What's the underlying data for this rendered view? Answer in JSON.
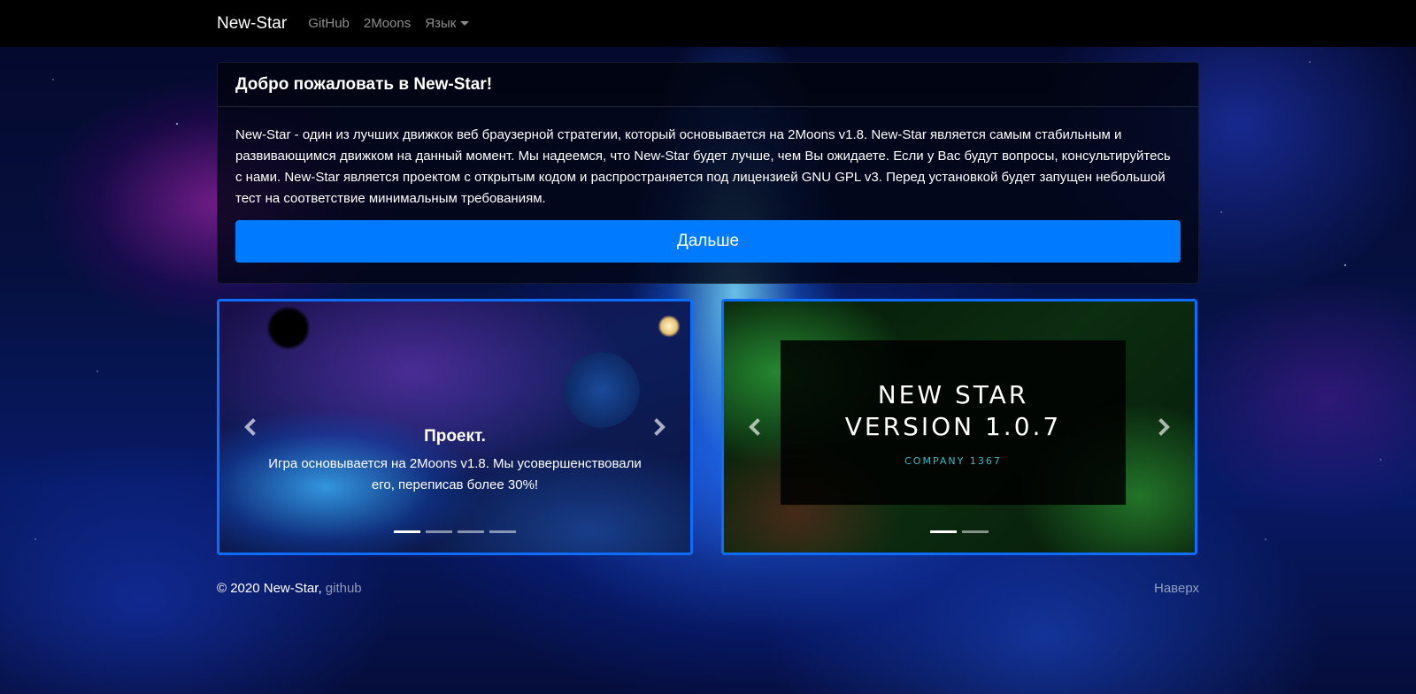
{
  "navbar": {
    "brand": "New-Star",
    "links": [
      {
        "label": "GitHub"
      },
      {
        "label": "2Moons"
      },
      {
        "label": "Язык"
      }
    ]
  },
  "welcome": {
    "title": "Добро пожаловать в New-Star!",
    "text": "New-Star - один из лучших движкок веб браузерной стратегии, который основывается на 2Moons v1.8. New-Star является самым стабильным и развивающимся движком на данный момент. Мы надеемся, что New-Star будет лучше, чем Вы ожидаете. Если у Вас будут вопросы, консультируйтесь с нами. New-Star является проектом с открытым кодом и распространяется под лицензией GNU GPL v3. Перед установкой будет запущен небольшой тест на соответствие минимальным требованиям.",
    "button_label": "Дальше"
  },
  "carousel_left": {
    "caption_title": "Проект.",
    "caption_text": "Игра основывается на 2Moons v1.8. Мы усовершенствовали его, переписав более 30%!",
    "indicator_count": 4,
    "active_index": 0
  },
  "carousel_right": {
    "logo_line1": "NEW STAR",
    "logo_line2": "VERSION 1.0.7",
    "logo_company": "COMPANY 1367",
    "indicator_count": 2,
    "active_index": 0
  },
  "footer": {
    "copyright": "© 2020 New-Star, ",
    "github_link": "github",
    "top_link": "Наверх"
  },
  "colors": {
    "primary": "#007bff",
    "carousel_border": "#0d6efd",
    "navbar_bg": "#000000"
  }
}
